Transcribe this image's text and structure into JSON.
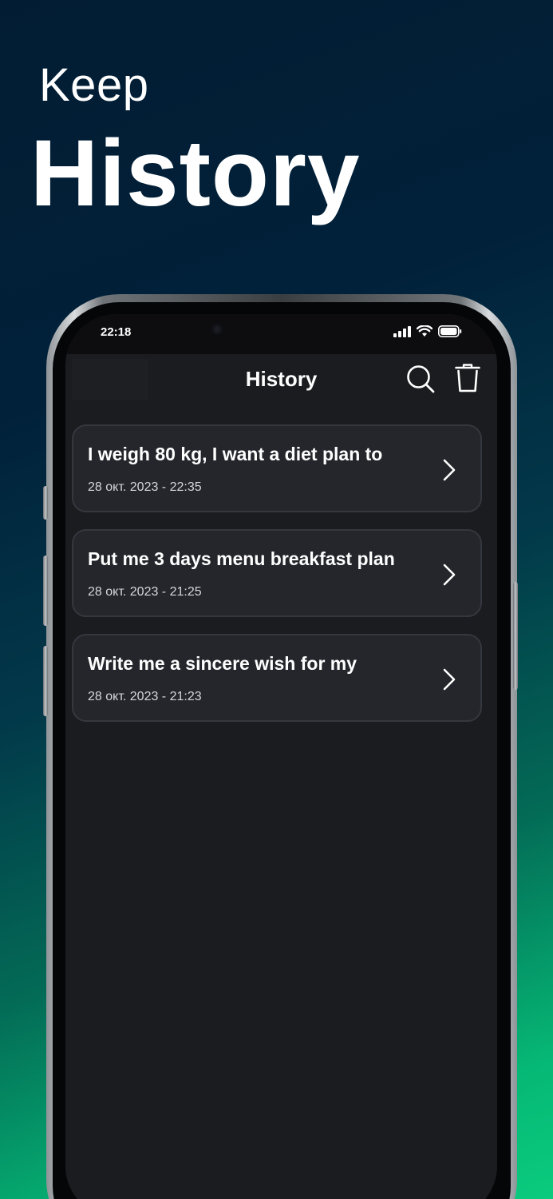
{
  "promo": {
    "line1": "Keep",
    "line2": "History"
  },
  "status_bar": {
    "time": "22:18"
  },
  "nav": {
    "title": "History"
  },
  "icons": {
    "search": "search-icon",
    "trash": "trash-icon",
    "chevron": "chevron-right-icon",
    "signal": "cellular-signal-icon",
    "wifi": "wifi-icon",
    "battery": "battery-icon"
  },
  "history": [
    {
      "title": "I weigh 80 kg, I want a diet plan to",
      "date": "28 окт. 2023 - 22:35"
    },
    {
      "title": "Put me 3 days menu breakfast plan",
      "date": "28 окт. 2023 - 21:25"
    },
    {
      "title": "Write me a sincere wish for my",
      "date": "28 окт. 2023 - 21:23"
    }
  ],
  "colors": {
    "background_top": "#021d33",
    "background_bottom": "#0acb7e",
    "screen": "#1b1c20",
    "card": "#25262c",
    "card_border": "#35373e",
    "text": "#ffffff"
  }
}
